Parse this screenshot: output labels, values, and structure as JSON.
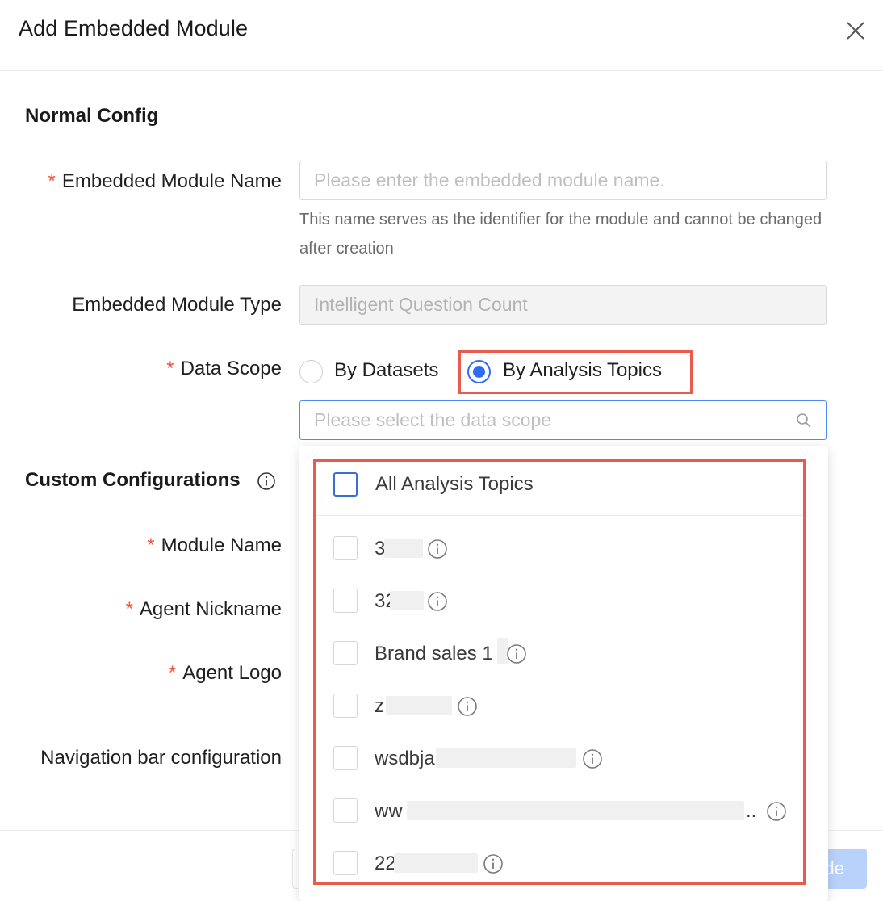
{
  "dialog": {
    "title": "Add Embedded Module"
  },
  "normal_config": {
    "section_title": "Normal Config",
    "module_name": {
      "required_mark": "*",
      "label": "Embedded Module Name",
      "placeholder": "Please enter the embedded module name.",
      "help": "This name serves as the identifier for the module and cannot be changed after creation"
    },
    "module_type": {
      "label": "Embedded Module Type",
      "value": "Intelligent Question Count"
    },
    "data_scope": {
      "required_mark": "*",
      "label": "Data Scope",
      "options": [
        "By Datasets",
        "By Analysis Topics"
      ],
      "selected": "By Analysis Topics",
      "placeholder": "Please select the data scope"
    }
  },
  "custom_config": {
    "section_title": "Custom Configurations",
    "module_name_label": "Module Name",
    "agent_nickname_label": "Agent Nickname",
    "agent_logo_label": "Agent Logo",
    "nav_bar_label": "Navigation bar configuration",
    "required_mark": "*"
  },
  "dropdown": {
    "all_label": "All Analysis Topics",
    "items": [
      {
        "label": "3"
      },
      {
        "label": "32"
      },
      {
        "label": "Brand sales 1"
      },
      {
        "label": "z"
      },
      {
        "label": "wsdbja"
      },
      {
        "label": "ww",
        "suffix": ".."
      },
      {
        "label": "22"
      }
    ]
  },
  "footer": {
    "primary_partial": "de"
  },
  "colors": {
    "accent": "#2f6cf5",
    "highlight": "#e95b4d",
    "required": "#f2553e"
  }
}
